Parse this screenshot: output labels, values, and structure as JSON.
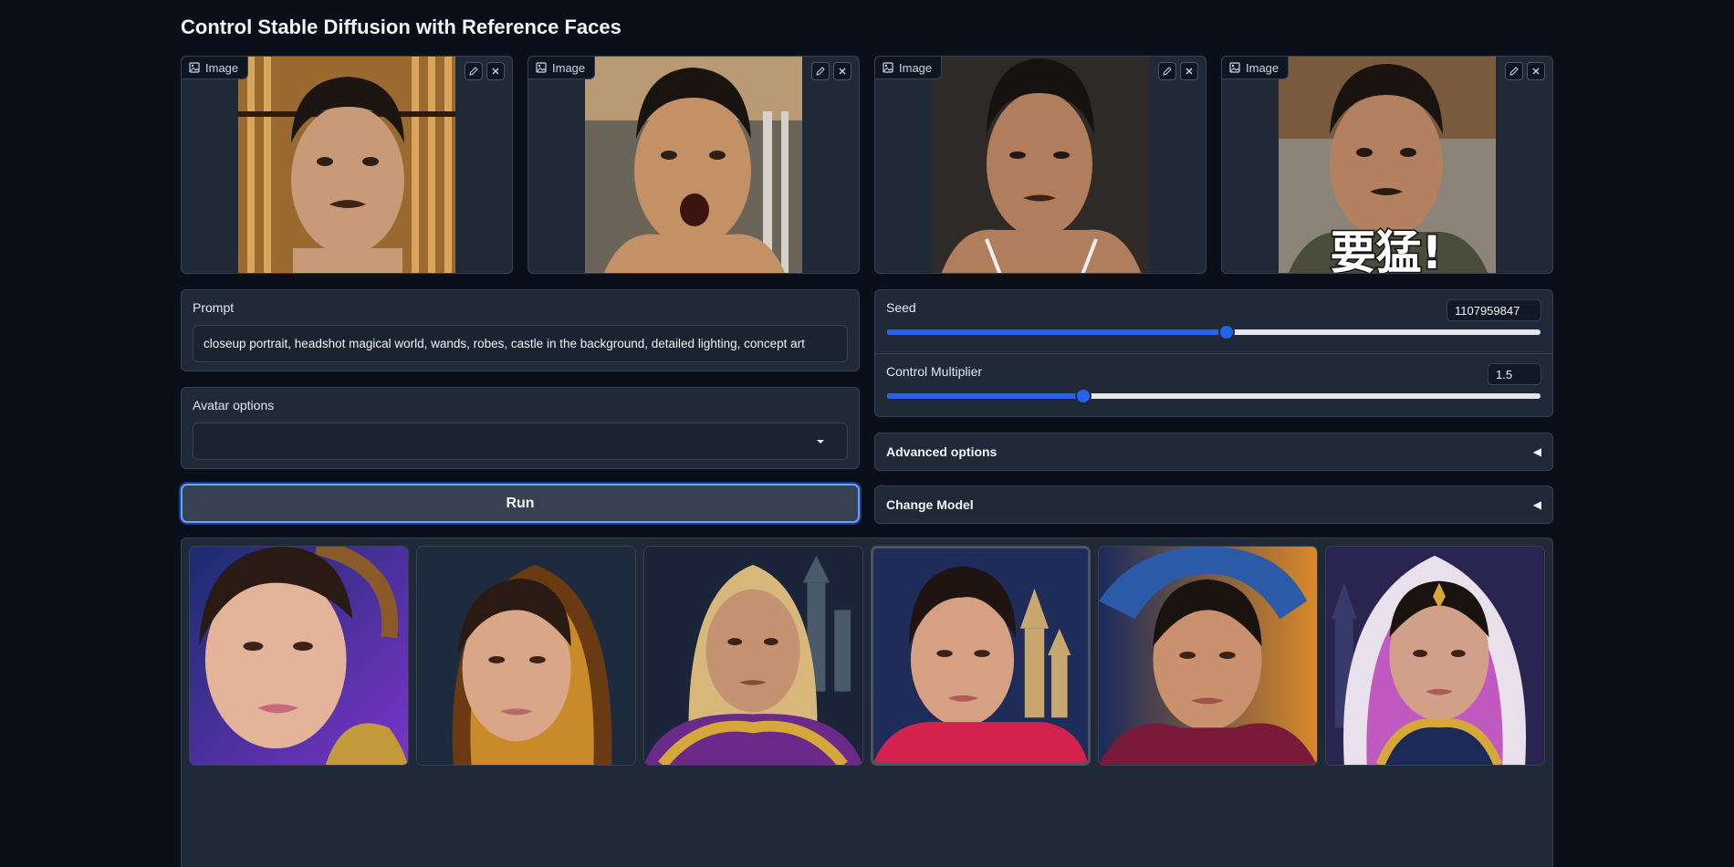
{
  "page": {
    "title": "Control Stable Diffusion with Reference Faces"
  },
  "reference_images": [
    {
      "label": "Image",
      "edit_icon": "pencil-icon",
      "close_icon": "close-icon"
    },
    {
      "label": "Image",
      "edit_icon": "pencil-icon",
      "close_icon": "close-icon"
    },
    {
      "label": "Image",
      "edit_icon": "pencil-icon",
      "close_icon": "close-icon"
    },
    {
      "label": "Image",
      "edit_icon": "pencil-icon",
      "close_icon": "close-icon"
    }
  ],
  "reference_image_4_overlay_text": "要猛!",
  "prompt": {
    "label": "Prompt",
    "value": "closeup portrait, headshot magical world, wands, robes, castle in the background, detailed lighting, concept art"
  },
  "avatar": {
    "label": "Avatar options",
    "selected": "",
    "icon": "chevron-down-icon"
  },
  "run": {
    "label": "Run"
  },
  "seed": {
    "label": "Seed",
    "value": "1107959847",
    "level": 0.52
  },
  "control_multiplier": {
    "label": "Control Multiplier",
    "value": "1.5",
    "level": 0.3
  },
  "advanced": {
    "label": "Advanced options",
    "caret": "◀"
  },
  "change_model": {
    "label": "Change Model",
    "caret": "◀"
  },
  "colors": {
    "accent": "#2563eb",
    "background": "#0b0f19",
    "panel": "#1f2937"
  }
}
